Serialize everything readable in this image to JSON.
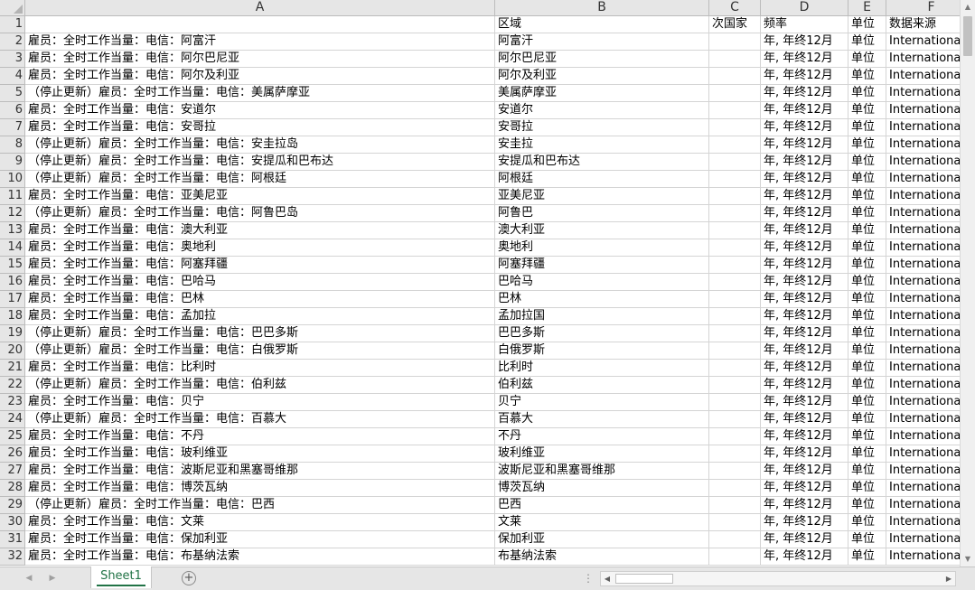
{
  "columns": [
    {
      "letter": "A"
    },
    {
      "letter": "B"
    },
    {
      "letter": "C"
    },
    {
      "letter": "D"
    },
    {
      "letter": "E"
    },
    {
      "letter": "F"
    }
  ],
  "rows": [
    {
      "num": "1",
      "cells": [
        "",
        "区域",
        "次国家",
        "频率",
        "单位",
        "数据来源"
      ]
    },
    {
      "num": "2",
      "cells": [
        "雇员：全时工作当量：电信：阿富汗",
        "阿富汗",
        "",
        "年, 年终12月",
        "单位",
        "International"
      ]
    },
    {
      "num": "3",
      "cells": [
        "雇员：全时工作当量：电信：阿尔巴尼亚",
        "阿尔巴尼亚",
        "",
        "年, 年终12月",
        "单位",
        "International"
      ]
    },
    {
      "num": "4",
      "cells": [
        "雇员：全时工作当量：电信：阿尔及利亚",
        "阿尔及利亚",
        "",
        "年, 年终12月",
        "单位",
        "International"
      ]
    },
    {
      "num": "5",
      "cells": [
        "（停止更新）雇员：全时工作当量：电信：美属萨摩亚",
        "美属萨摩亚",
        "",
        "年, 年终12月",
        "单位",
        "International"
      ]
    },
    {
      "num": "6",
      "cells": [
        "雇员：全时工作当量：电信：安道尔",
        "安道尔",
        "",
        "年, 年终12月",
        "单位",
        "International"
      ]
    },
    {
      "num": "7",
      "cells": [
        "雇员：全时工作当量：电信：安哥拉",
        "安哥拉",
        "",
        "年, 年终12月",
        "单位",
        "International"
      ]
    },
    {
      "num": "8",
      "cells": [
        "（停止更新）雇员：全时工作当量：电信：安圭拉岛",
        "安圭拉",
        "",
        "年, 年终12月",
        "单位",
        "International"
      ]
    },
    {
      "num": "9",
      "cells": [
        "（停止更新）雇员：全时工作当量：电信：安提瓜和巴布达",
        "安提瓜和巴布达",
        "",
        "年, 年终12月",
        "单位",
        "International"
      ]
    },
    {
      "num": "10",
      "cells": [
        "（停止更新）雇员：全时工作当量：电信：阿根廷",
        "阿根廷",
        "",
        "年, 年终12月",
        "单位",
        "International"
      ]
    },
    {
      "num": "11",
      "cells": [
        "雇员：全时工作当量：电信：亚美尼亚",
        "亚美尼亚",
        "",
        "年, 年终12月",
        "单位",
        "International"
      ]
    },
    {
      "num": "12",
      "cells": [
        "（停止更新）雇员：全时工作当量：电信：阿鲁巴岛",
        "阿鲁巴",
        "",
        "年, 年终12月",
        "单位",
        "International"
      ]
    },
    {
      "num": "13",
      "cells": [
        "雇员：全时工作当量：电信：澳大利亚",
        "澳大利亚",
        "",
        "年, 年终12月",
        "单位",
        "International"
      ]
    },
    {
      "num": "14",
      "cells": [
        "雇员：全时工作当量：电信：奥地利",
        "奥地利",
        "",
        "年, 年终12月",
        "单位",
        "International"
      ]
    },
    {
      "num": "15",
      "cells": [
        "雇员：全时工作当量：电信：阿塞拜疆",
        "阿塞拜疆",
        "",
        "年, 年终12月",
        "单位",
        "International"
      ]
    },
    {
      "num": "16",
      "cells": [
        "雇员：全时工作当量：电信：巴哈马",
        "巴哈马",
        "",
        "年, 年终12月",
        "单位",
        "International"
      ]
    },
    {
      "num": "17",
      "cells": [
        "雇员：全时工作当量：电信：巴林",
        "巴林",
        "",
        "年, 年终12月",
        "单位",
        "International"
      ]
    },
    {
      "num": "18",
      "cells": [
        "雇员：全时工作当量：电信：孟加拉",
        "孟加拉国",
        "",
        "年, 年终12月",
        "单位",
        "International"
      ]
    },
    {
      "num": "19",
      "cells": [
        "（停止更新）雇员：全时工作当量：电信：巴巴多斯",
        "巴巴多斯",
        "",
        "年, 年终12月",
        "单位",
        "International"
      ]
    },
    {
      "num": "20",
      "cells": [
        "（停止更新）雇员：全时工作当量：电信：白俄罗斯",
        "白俄罗斯",
        "",
        "年, 年终12月",
        "单位",
        "International"
      ]
    },
    {
      "num": "21",
      "cells": [
        "雇员：全时工作当量：电信：比利时",
        "比利时",
        "",
        "年, 年终12月",
        "单位",
        "International"
      ]
    },
    {
      "num": "22",
      "cells": [
        "（停止更新）雇员：全时工作当量：电信：伯利兹",
        "伯利兹",
        "",
        "年, 年终12月",
        "单位",
        "International"
      ]
    },
    {
      "num": "23",
      "cells": [
        "雇员：全时工作当量：电信：贝宁",
        "贝宁",
        "",
        "年, 年终12月",
        "单位",
        "International"
      ]
    },
    {
      "num": "24",
      "cells": [
        "（停止更新）雇员：全时工作当量：电信：百慕大",
        "百慕大",
        "",
        "年, 年终12月",
        "单位",
        "International"
      ]
    },
    {
      "num": "25",
      "cells": [
        "雇员：全时工作当量：电信：不丹",
        "不丹",
        "",
        "年, 年终12月",
        "单位",
        "International"
      ]
    },
    {
      "num": "26",
      "cells": [
        "雇员：全时工作当量：电信：玻利维亚",
        "玻利维亚",
        "",
        "年, 年终12月",
        "单位",
        "International"
      ]
    },
    {
      "num": "27",
      "cells": [
        "雇员：全时工作当量：电信：波斯尼亚和黑塞哥维那",
        "波斯尼亚和黑塞哥维那",
        "",
        "年, 年终12月",
        "单位",
        "International"
      ]
    },
    {
      "num": "28",
      "cells": [
        "雇员：全时工作当量：电信：博茨瓦纳",
        "博茨瓦纳",
        "",
        "年, 年终12月",
        "单位",
        "International"
      ]
    },
    {
      "num": "29",
      "cells": [
        "（停止更新）雇员：全时工作当量：电信：巴西",
        "巴西",
        "",
        "年, 年终12月",
        "单位",
        "International"
      ]
    },
    {
      "num": "30",
      "cells": [
        "雇员：全时工作当量：电信：文莱",
        "文莱",
        "",
        "年, 年终12月",
        "单位",
        "International"
      ]
    },
    {
      "num": "31",
      "cells": [
        "雇员：全时工作当量：电信：保加利亚",
        "保加利亚",
        "",
        "年, 年终12月",
        "单位",
        "International"
      ]
    },
    {
      "num": "32",
      "cells": [
        "雇员：全时工作当量：电信：布基纳法索",
        "布基纳法索",
        "",
        "年, 年终12月",
        "单位",
        "International"
      ]
    }
  ],
  "sheet_tabs": [
    {
      "label": "Sheet1",
      "active": true
    }
  ],
  "icons": {
    "add_sheet": "plus-circle-icon",
    "scroll_up": "triangle-up-icon",
    "scroll_down": "triangle-down-icon",
    "scroll_left": "triangle-left-icon",
    "scroll_right": "triangle-right-icon"
  },
  "colors": {
    "header_bg": "#e6e6e6",
    "grid_line": "#d4d4d4",
    "active_tab_text": "#217346"
  }
}
